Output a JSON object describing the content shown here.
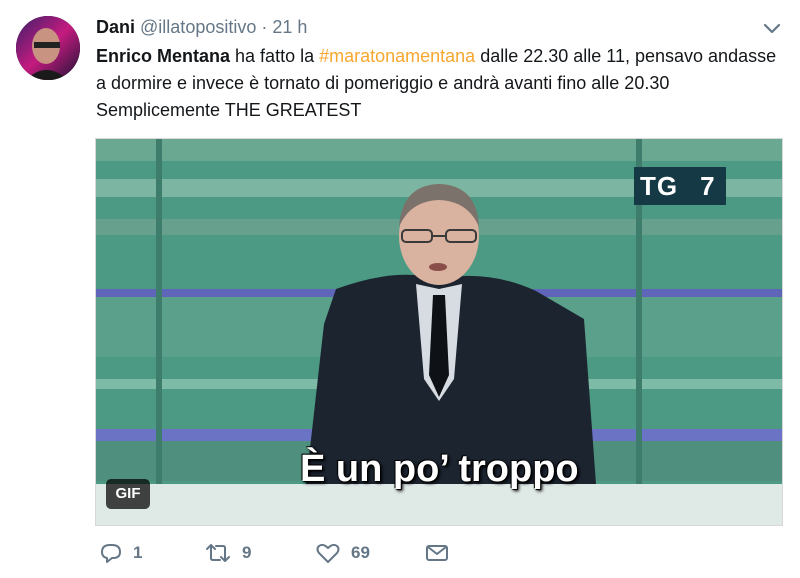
{
  "tweet": {
    "author_name": "Dani",
    "handle": "@illatopositivo",
    "separator": "·",
    "time": "21 h",
    "text_mention": "Enrico Mentana",
    "text_part1": " ha fatto la ",
    "hashtag": "#maratonamentana",
    "text_part2": " dalle 22.30 alle 11, pensavo andasse a dormire e invece è tornato di pomeriggio e andrà avanti fino alle 20.30 Semplicemente THE GREATEST"
  },
  "media": {
    "caption": "È un po’ troppo",
    "gif_label": "GIF",
    "channel_logo": "TG",
    "channel_logo_suffix": "7"
  },
  "actions": {
    "reply_count": "1",
    "retweet_count": "9",
    "like_count": "69"
  },
  "icons": {
    "menu": "chevron-down-icon",
    "reply": "reply-icon",
    "retweet": "retweet-icon",
    "like": "heart-icon",
    "dm": "envelope-icon"
  },
  "colors": {
    "hashtag": "#f7a72f",
    "muted": "#657786",
    "text": "#14171a"
  }
}
